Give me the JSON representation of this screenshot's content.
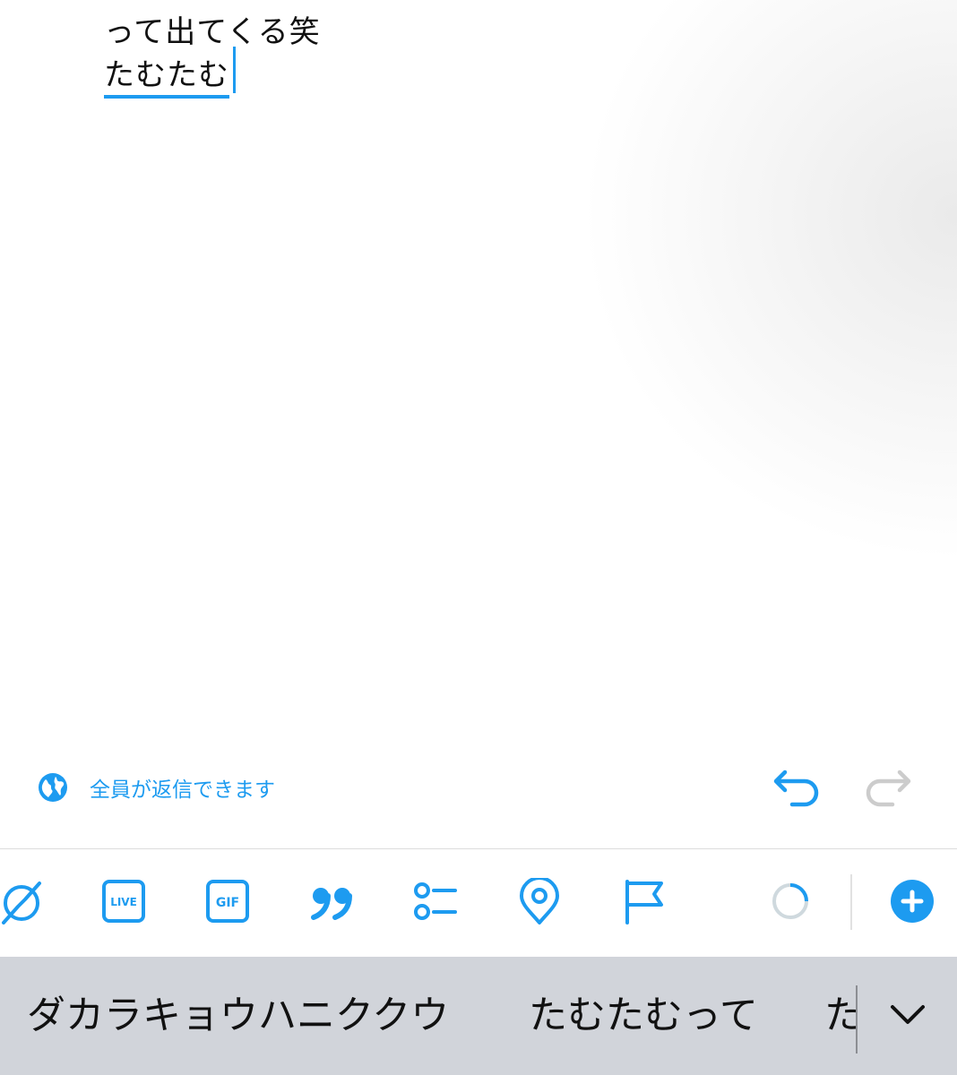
{
  "compose": {
    "line1": "って出てくる笑",
    "line2": "たむたむ"
  },
  "reply_setting": {
    "label": "全員が返信できます",
    "icon": "globe-icon"
  },
  "history": {
    "undo_icon": "undo-icon",
    "redo_icon": "redo-icon"
  },
  "toolbar": {
    "items": [
      {
        "icon": "compass-icon"
      },
      {
        "icon": "live-icon",
        "label": "LIVE"
      },
      {
        "icon": "gif-icon",
        "label": "GIF"
      },
      {
        "icon": "quote-icon"
      },
      {
        "icon": "poll-icon"
      },
      {
        "icon": "location-icon"
      },
      {
        "icon": "flag-icon"
      },
      {
        "icon": "character-count-ring"
      },
      {
        "icon": "add-thread-icon"
      }
    ]
  },
  "keyboard": {
    "candidates": [
      "ダカラキョウハニククウ",
      "たむたむって",
      "た"
    ],
    "expand_icon": "chevron-down-icon"
  },
  "colors": {
    "accent": "#1d9bf0",
    "disabled": "#cccccc",
    "keyboard_bg": "#d1d4da"
  }
}
